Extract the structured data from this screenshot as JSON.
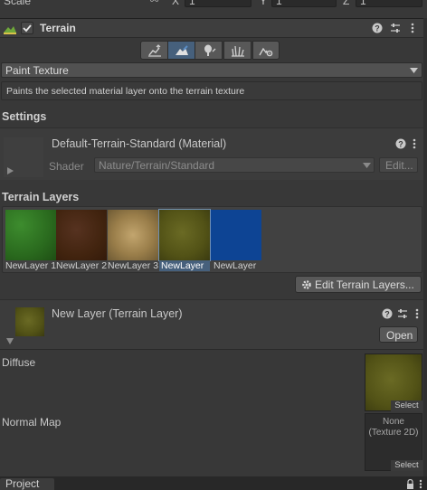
{
  "top_row": {
    "label": "Scale",
    "x_label": "X",
    "x_value": "1",
    "y_label": "Y",
    "y_value": "1",
    "z_label": "Z",
    "z_value": "1"
  },
  "component": {
    "title": "Terrain",
    "enabled": true
  },
  "toolbar": {
    "icons": [
      "raise-lower-terrain-icon",
      "paint-terrain-icon",
      "paint-trees-icon",
      "paint-details-icon",
      "terrain-settings-icon"
    ],
    "active_index": 1
  },
  "tool_dropdown": {
    "value": "Paint Texture"
  },
  "tool_description": "Paints the selected material layer onto the terrain texture",
  "settings": {
    "heading": "Settings",
    "material_name": "Default-Terrain-Standard (Material)",
    "shader_label": "Shader",
    "shader_value": "Nature/Terrain/Standard",
    "edit_button": "Edit..."
  },
  "terrain_layers": {
    "heading": "Terrain Layers",
    "layers": [
      {
        "label": "NewLayer 1",
        "color": "#2f7a23"
      },
      {
        "label": "NewLayer 2",
        "color": "#4a2a16"
      },
      {
        "label": "NewLayer 3",
        "color": "#a88a5a"
      },
      {
        "label": "NewLayer",
        "color": "#5a5a1a"
      },
      {
        "label": "NewLayer",
        "color": "#0d4494"
      }
    ],
    "selected_index": 3,
    "edit_button": "Edit Terrain Layers..."
  },
  "layer_inspector": {
    "title": "New Layer (Terrain Layer)",
    "open_button": "Open",
    "diffuse_label": "Diffuse",
    "diffuse_select": "Select",
    "normal_label": "Normal Map",
    "normal_none": "None",
    "normal_type": "(Texture 2D)",
    "normal_select": "Select"
  },
  "bottom_bar": {
    "tab": "Project"
  },
  "colors": {
    "accent": "#46607c",
    "panel": "#383838",
    "header": "#3e3e3e"
  }
}
